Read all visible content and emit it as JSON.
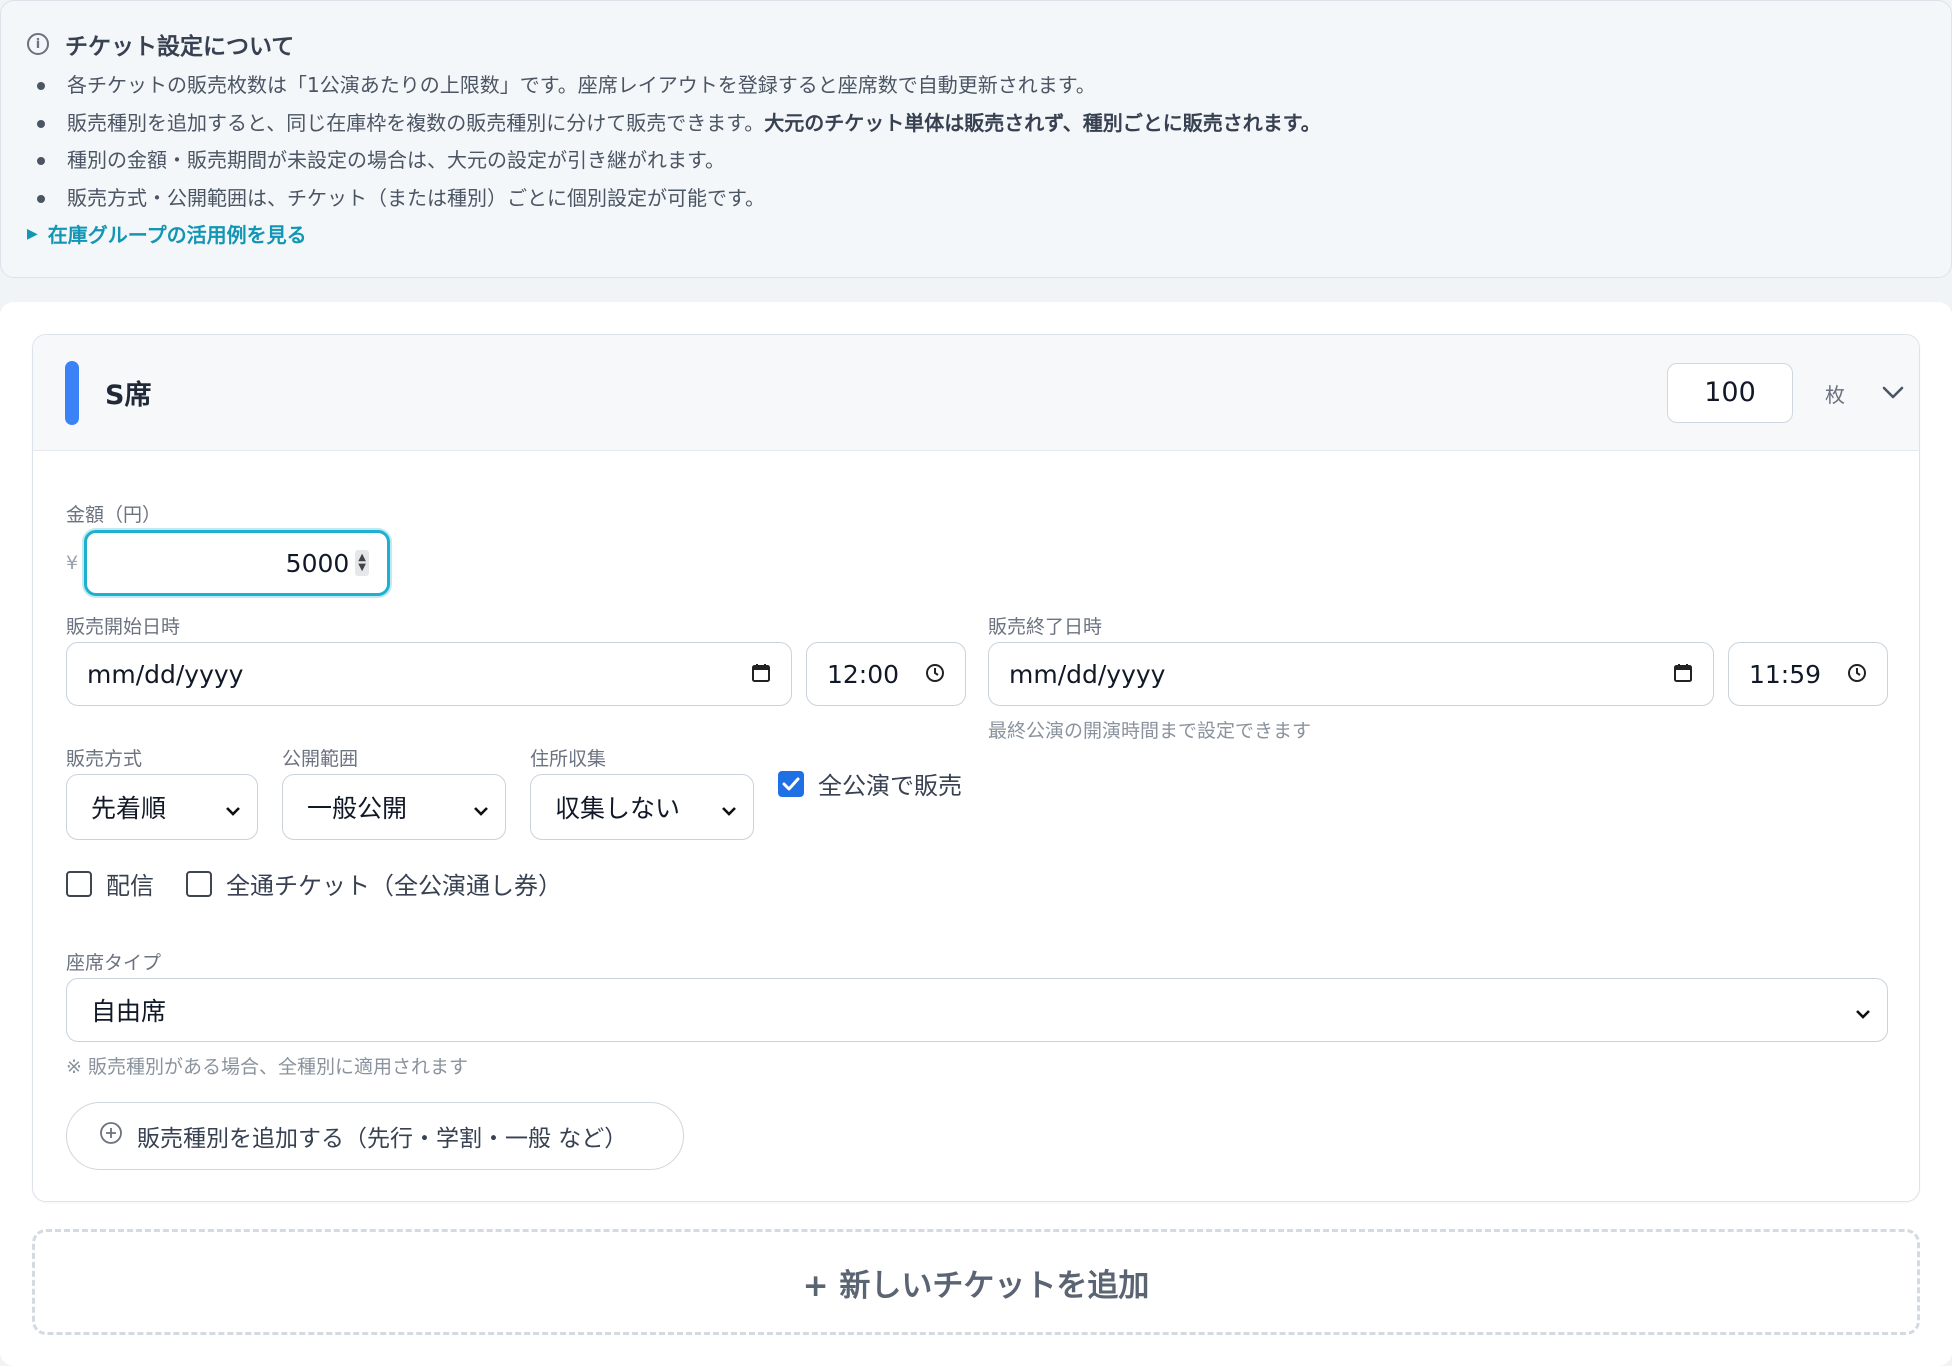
{
  "info": {
    "title": "チケット設定について",
    "items": [
      {
        "text": "各チケットの販売枚数は「1公演あたりの上限数」です。座席レイアウトを登録すると座席数で自動更新されます。",
        "bold": ""
      },
      {
        "text": "販売種別を追加すると、同じ在庫枠を複数の販売種別に分けて販売できます。",
        "bold": "大元のチケット単体は販売されず、種別ごとに販売されます。"
      },
      {
        "text": "種別の金額・販売期間が未設定の場合は、大元の設定が引き継がれます。",
        "bold": ""
      },
      {
        "text": "販売方式・公開範囲は、チケット（または種別）ごとに個別設定が可能です。",
        "bold": ""
      }
    ],
    "link": "在庫グループの活用例を見る"
  },
  "ticket": {
    "name": "S席",
    "quantity": "100",
    "quantity_unit": "枚",
    "price_label": "金額（円）",
    "currency_symbol": "¥",
    "price": "5000",
    "sale_start_label": "販売開始日時",
    "sale_start_date": "mm/dd/yyyy",
    "sale_start_time": "12:00",
    "sale_end_label": "販売終了日時",
    "sale_end_date": "mm/dd/yyyy",
    "sale_end_time": "11:59",
    "sale_end_hint": "最終公演の開演時間まで設定できます",
    "method_label": "販売方式",
    "method_value": "先着順",
    "visibility_label": "公開範囲",
    "visibility_value": "一般公開",
    "address_label": "住所収集",
    "address_value": "収集しない",
    "all_shows_label": "全公演で販売",
    "all_shows_checked": true,
    "streaming_label": "配信",
    "streaming_checked": false,
    "season_pass_label": "全通チケット（全公演通し券）",
    "season_pass_checked": false,
    "seat_type_label": "座席タイプ",
    "seat_type_value": "自由席",
    "seat_type_hint": "※ 販売種別がある場合、全種別に適用されます",
    "add_variant_label": "販売種別を追加する（先行・学割・一般 など）"
  },
  "new_ticket_label": "+ 新しいチケットを追加",
  "colors": {
    "accent": "#3b82f6",
    "focus": "#1fb0cf",
    "link": "#1296b4",
    "checkbox": "#1f6fe5"
  }
}
